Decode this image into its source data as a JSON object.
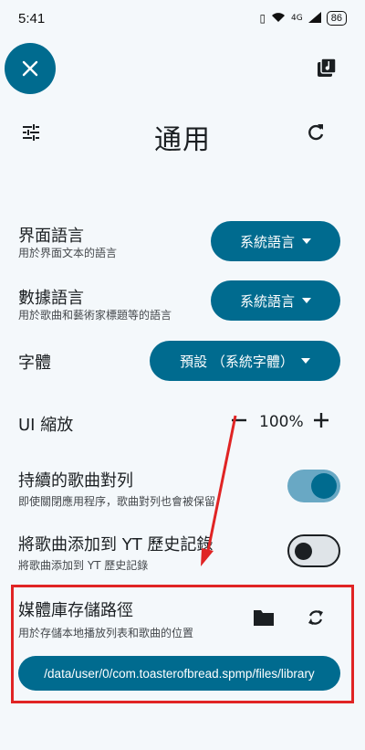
{
  "status_bar": {
    "time": "5:41",
    "battery": "86",
    "network_label": "4G"
  },
  "header": {
    "title": "通用"
  },
  "settings": {
    "interface_language": {
      "title": "界面語言",
      "subtitle": "用於界面文本的語言",
      "value": "系統語言"
    },
    "data_language": {
      "title": "數據語言",
      "subtitle": "用於歌曲和藝術家標題等的語言",
      "value": "系統語言"
    },
    "font": {
      "title": "字體",
      "value": "預設 （系統字體）"
    },
    "ui_scale": {
      "title": "UI 縮放",
      "value": "100%"
    },
    "persistent_queue": {
      "title": "持續的歌曲對列",
      "subtitle": "即使關閉應用程序，歌曲對列也會被保留",
      "enabled": true
    },
    "add_to_yt_history": {
      "title": "將歌曲添加到 YT 歷史記錄",
      "subtitle": "將歌曲添加到 YT 歷史記錄",
      "enabled": false
    },
    "media_library_path": {
      "title": "媒體庫存儲路徑",
      "subtitle": "用於存儲本地播放列表和歌曲的位置",
      "path": "/data/user/0/com.toasterofbread.spmp/files/library"
    }
  },
  "colors": {
    "accent": "#006b8f",
    "switch_track_on": "#69a8c4",
    "annotation": "#e02424",
    "background": "#f4f8fb"
  },
  "icons": [
    "close-icon",
    "music-library-icon",
    "tune-icon",
    "reset-icon",
    "chevron-down-icon",
    "minus-icon",
    "plus-icon",
    "folder-icon",
    "sync-icon"
  ]
}
